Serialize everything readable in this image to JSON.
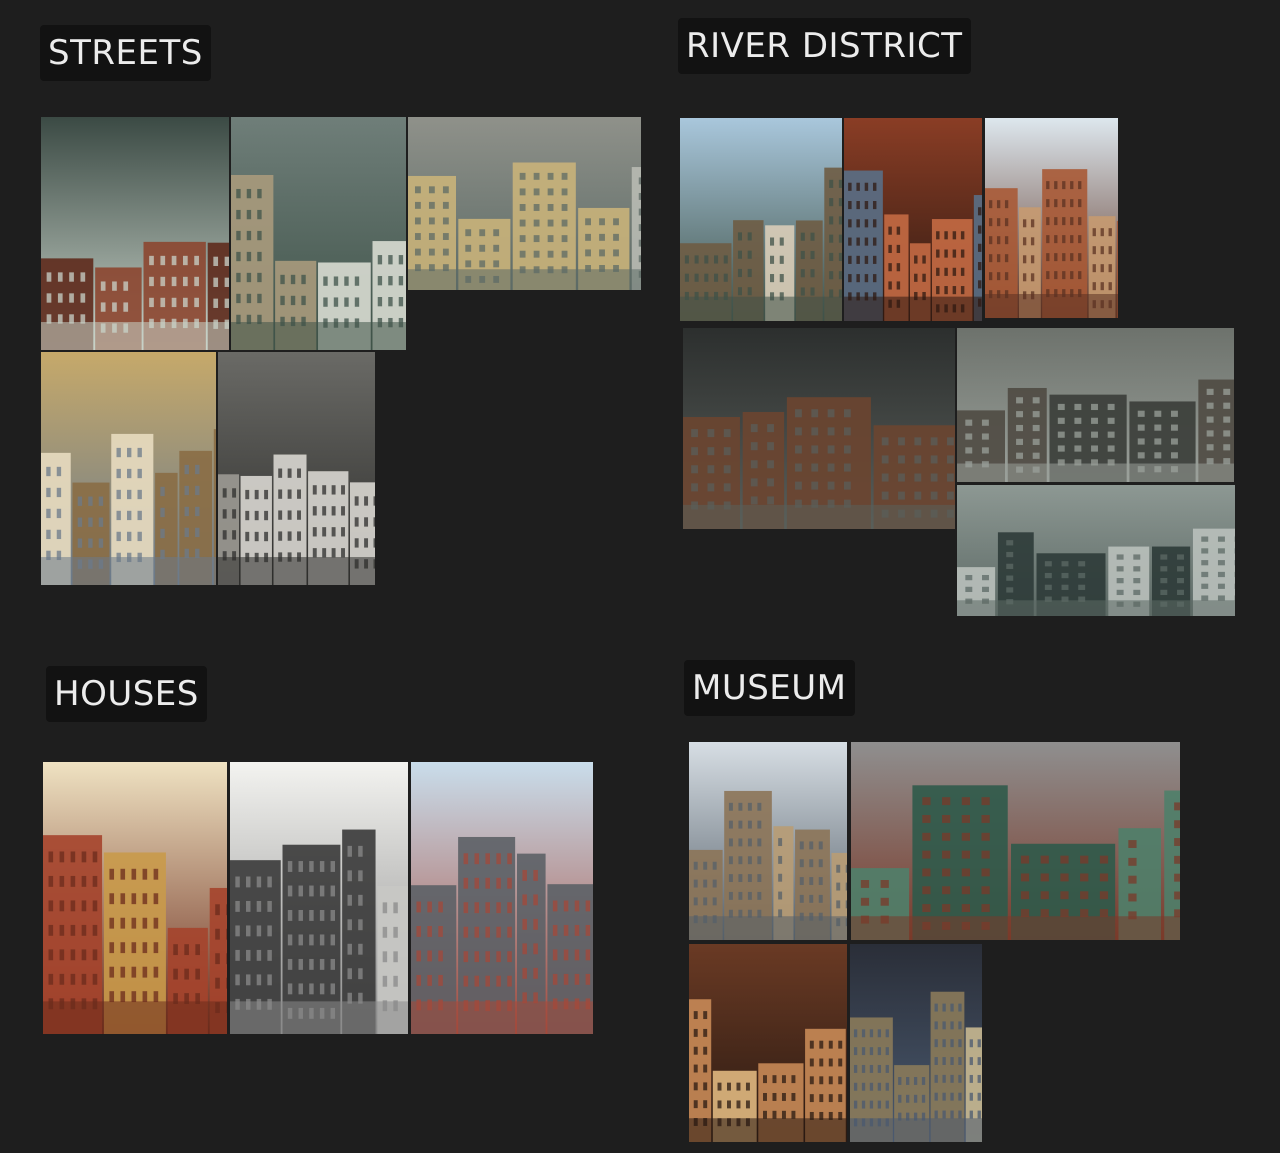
{
  "board": {
    "sections": {
      "streets": {
        "title": "STREETS",
        "images": [
          {
            "icon": "gothic-canal-street-painting",
            "colors": [
              "#3b4a44",
              "#8c4630",
              "#c9d3c9",
              "#5e2a1c"
            ]
          },
          {
            "icon": "parisian-corner-building-painting",
            "colors": [
              "#6f7e79",
              "#d8dcd2",
              "#3f5349",
              "#a89a7c"
            ]
          },
          {
            "icon": "tram-bridge-street-painting",
            "colors": [
              "#8f918a",
              "#c9b27a",
              "#5d6b66",
              "#b8bab2"
            ]
          },
          {
            "icon": "aerial-city-blocks-illustration",
            "colors": [
              "#c6a96a",
              "#e8dcc0",
              "#6b7a8a",
              "#8a6d45"
            ]
          },
          {
            "icon": "vintage-street-photo-with-cars",
            "colors": [
              "#6a6a66",
              "#d8d6d0",
              "#2e2e2c",
              "#9c9a94"
            ]
          }
        ]
      },
      "river_district": {
        "title": "RIVER DISTRICT",
        "images": [
          {
            "icon": "seine-riverside-buildings-photo",
            "colors": [
              "#a9c7dc",
              "#d9cdb8",
              "#3f5248",
              "#6e5c44"
            ]
          },
          {
            "icon": "red-brick-canal-reflection-photo",
            "colors": [
              "#8a3d25",
              "#c46a44",
              "#2f1a12",
              "#5a6f86"
            ]
          },
          {
            "icon": "ruined-brick-tower-photo",
            "colors": [
              "#dde7ee",
              "#a85a36",
              "#5b3222",
              "#c79a70"
            ]
          },
          {
            "icon": "abandoned-brick-factory-yard-render",
            "colors": [
              "#2c2f2e",
              "#6b4530",
              "#595e5a",
              "#8a8c86"
            ]
          },
          {
            "icon": "industrial-canal-smokestack-render",
            "colors": [
              "#6d726c",
              "#3a3d39",
              "#9aa09a",
              "#4f4a42"
            ]
          },
          {
            "icon": "foggy-terraced-street-render",
            "colors": [
              "#8d9893",
              "#2e3b38",
              "#5c6965",
              "#b9c0bb"
            ]
          }
        ]
      },
      "houses": {
        "title": "HOUSES",
        "images": [
          {
            "icon": "brick-townhouse-elevation-drawing",
            "colors": [
              "#efe2c2",
              "#a5442c",
              "#6b2b1c",
              "#c99a4a"
            ]
          },
          {
            "icon": "ink-house-plan-engraving",
            "colors": [
              "#f3f3f0",
              "#3a3a3a",
              "#8a8a8a",
              "#c8c8c4"
            ]
          },
          {
            "icon": "brick-mansard-facade-photo",
            "colors": [
              "#c9ddeb",
              "#5c6066",
              "#a4483a",
              "#d8c6a8"
            ]
          }
        ]
      },
      "museum": {
        "title": "MUSEUM",
        "images": [
          {
            "icon": "orsay-museum-riverside-photo",
            "colors": [
              "#d7dee4",
              "#b89c74",
              "#55606a",
              "#8c7458"
            ]
          },
          {
            "icon": "green-domed-museum-model",
            "colors": [
              "#8f8f8f",
              "#2f5a4a",
              "#7a3a2a",
              "#4f7f6a"
            ]
          },
          {
            "icon": "natural-history-hall-interior-photo",
            "colors": [
              "#6a3a24",
              "#c88a56",
              "#2a1a12",
              "#e0b880"
            ]
          },
          {
            "icon": "grand-station-hall-interior-photo",
            "colors": [
              "#2a2e38",
              "#8a7a5a",
              "#4a5a70",
              "#c8b890"
            ]
          }
        ]
      }
    }
  }
}
